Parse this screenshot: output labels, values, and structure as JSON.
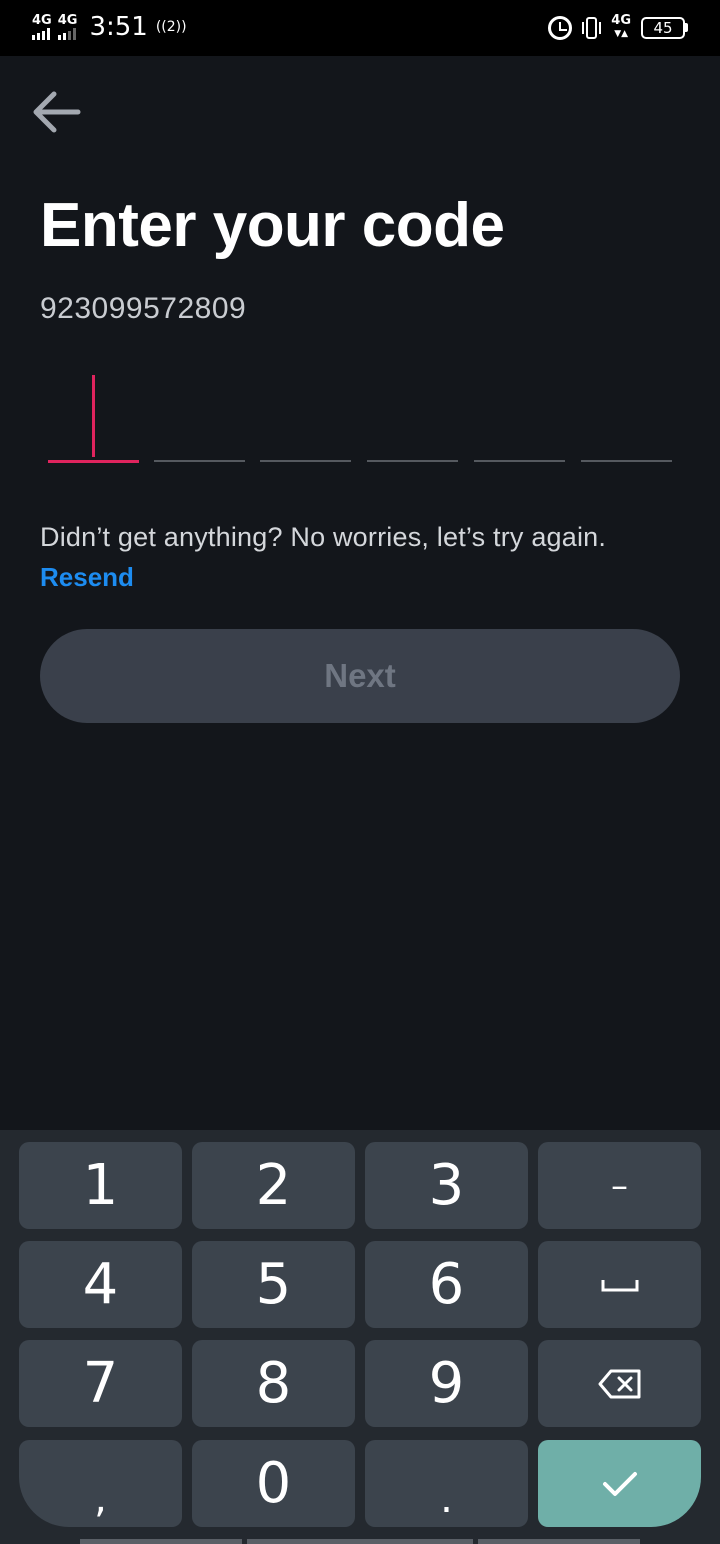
{
  "status_bar": {
    "time": "3:51",
    "network1": "4G",
    "network2": "4G",
    "hotspot": "((2))",
    "network_right": "4G",
    "battery": "45"
  },
  "header": {
    "title": "Enter your code",
    "phone_number": "923099572809"
  },
  "code": {
    "length": 6,
    "digits": [
      "",
      "",
      "",
      "",
      "",
      ""
    ],
    "active_index": 0,
    "accent_color": "#e0245e"
  },
  "help_text": "Didn’t get anything? No worries, let’s try again.",
  "resend_label": "Resend",
  "next_label": "Next",
  "keyboard": {
    "rows": [
      [
        "1",
        "2",
        "3",
        "–"
      ],
      [
        "4",
        "5",
        "6",
        "space-icon"
      ],
      [
        "7",
        "8",
        "9",
        "backspace-icon"
      ],
      [
        ",",
        "0",
        ".",
        "check-icon"
      ]
    ],
    "keys": {
      "k1": "1",
      "k2": "2",
      "k3": "3",
      "dash": "–",
      "k4": "4",
      "k5": "5",
      "k6": "6",
      "k7": "7",
      "k8": "8",
      "k9": "9",
      "comma": ",",
      "k0": "0",
      "dot": "."
    },
    "enter_color": "#6fafa8"
  }
}
